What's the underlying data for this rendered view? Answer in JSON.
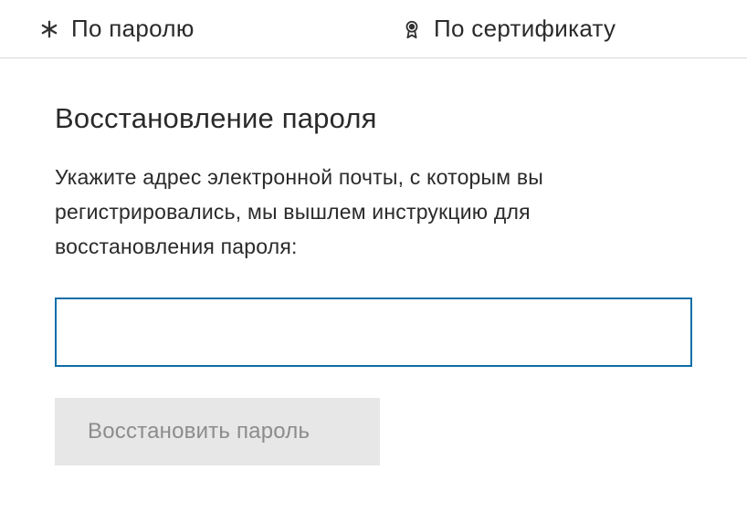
{
  "tabs": {
    "password": {
      "label": "По паролю"
    },
    "certificate": {
      "label": "По сертификату"
    }
  },
  "main": {
    "title": "Восстановление пароля",
    "description": "Укажите адрес электронной почты, с которым вы регистрировались, мы вышлем инструкцию для восстановления пароля:",
    "email_value": "",
    "restore_button_label": "Восстановить пароль"
  }
}
